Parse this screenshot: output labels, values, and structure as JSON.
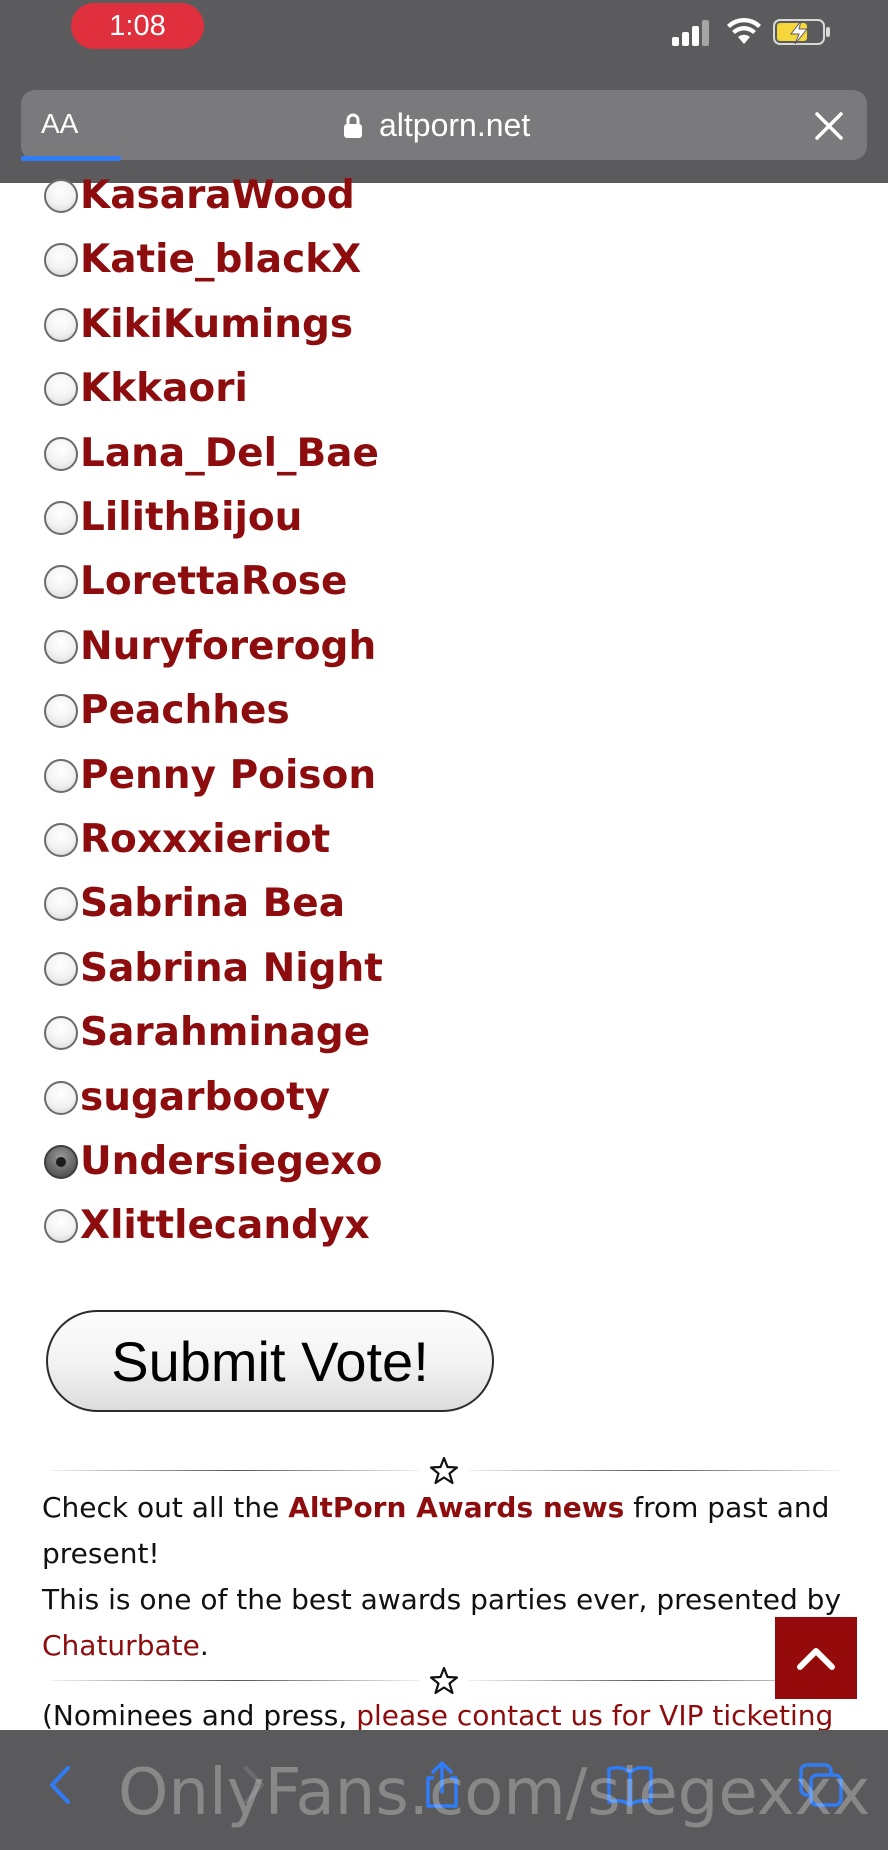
{
  "status_bar": {
    "time": "1:08"
  },
  "browser": {
    "text_size_label": "AA",
    "url": "altporn.net"
  },
  "vote_options": [
    {
      "label": "KasaraWood",
      "checked": false
    },
    {
      "label": "Katie_blackX",
      "checked": false
    },
    {
      "label": "KikiKumings",
      "checked": false
    },
    {
      "label": "Kkkaori",
      "checked": false
    },
    {
      "label": "Lana_Del_Bae",
      "checked": false
    },
    {
      "label": "LilithBijou",
      "checked": false
    },
    {
      "label": "LorettaRose",
      "checked": false
    },
    {
      "label": "Nuryforerogh",
      "checked": false
    },
    {
      "label": "Peachhes",
      "checked": false
    },
    {
      "label": "Penny Poison",
      "checked": false
    },
    {
      "label": "Roxxxieriot",
      "checked": false
    },
    {
      "label": "Sabrina Bea",
      "checked": false
    },
    {
      "label": "Sabrina Night",
      "checked": false
    },
    {
      "label": "Sarahminage",
      "checked": false
    },
    {
      "label": "sugarbooty",
      "checked": false
    },
    {
      "label": "Undersiegexo",
      "checked": true
    },
    {
      "label": "Xlittlecandyx",
      "checked": false
    }
  ],
  "submit_label": "Submit Vote!",
  "news": {
    "line1_prefix": "Check out all the ",
    "line1_link": "AltPorn Awards news",
    "line1_suffix": " from past and present!",
    "line2_prefix": "This is one of the best awards parties ever, presented by ",
    "line2_link": "Chaturbate",
    "line2_suffix": ".",
    "line3_prefix": "(Nominees and press, ",
    "line3_link": "please contact us for VIP ticketing"
  },
  "watermark": "OnlyFans.com/siegexxx",
  "colors": {
    "link": "#8d0c0e",
    "time_pill": "#e0303d",
    "chrome": "#5b5b5e",
    "to_top": "#950b0b",
    "toolbar_icon": "#2f7cf6"
  },
  "icons": {
    "lock": "lock-icon",
    "close": "close-icon",
    "to_top": "chevron-up-icon",
    "back": "back-arrow-icon",
    "forward": "forward-arrow-icon",
    "share": "share-icon",
    "bookmarks": "bookmarks-icon",
    "tabs": "tabs-icon"
  }
}
